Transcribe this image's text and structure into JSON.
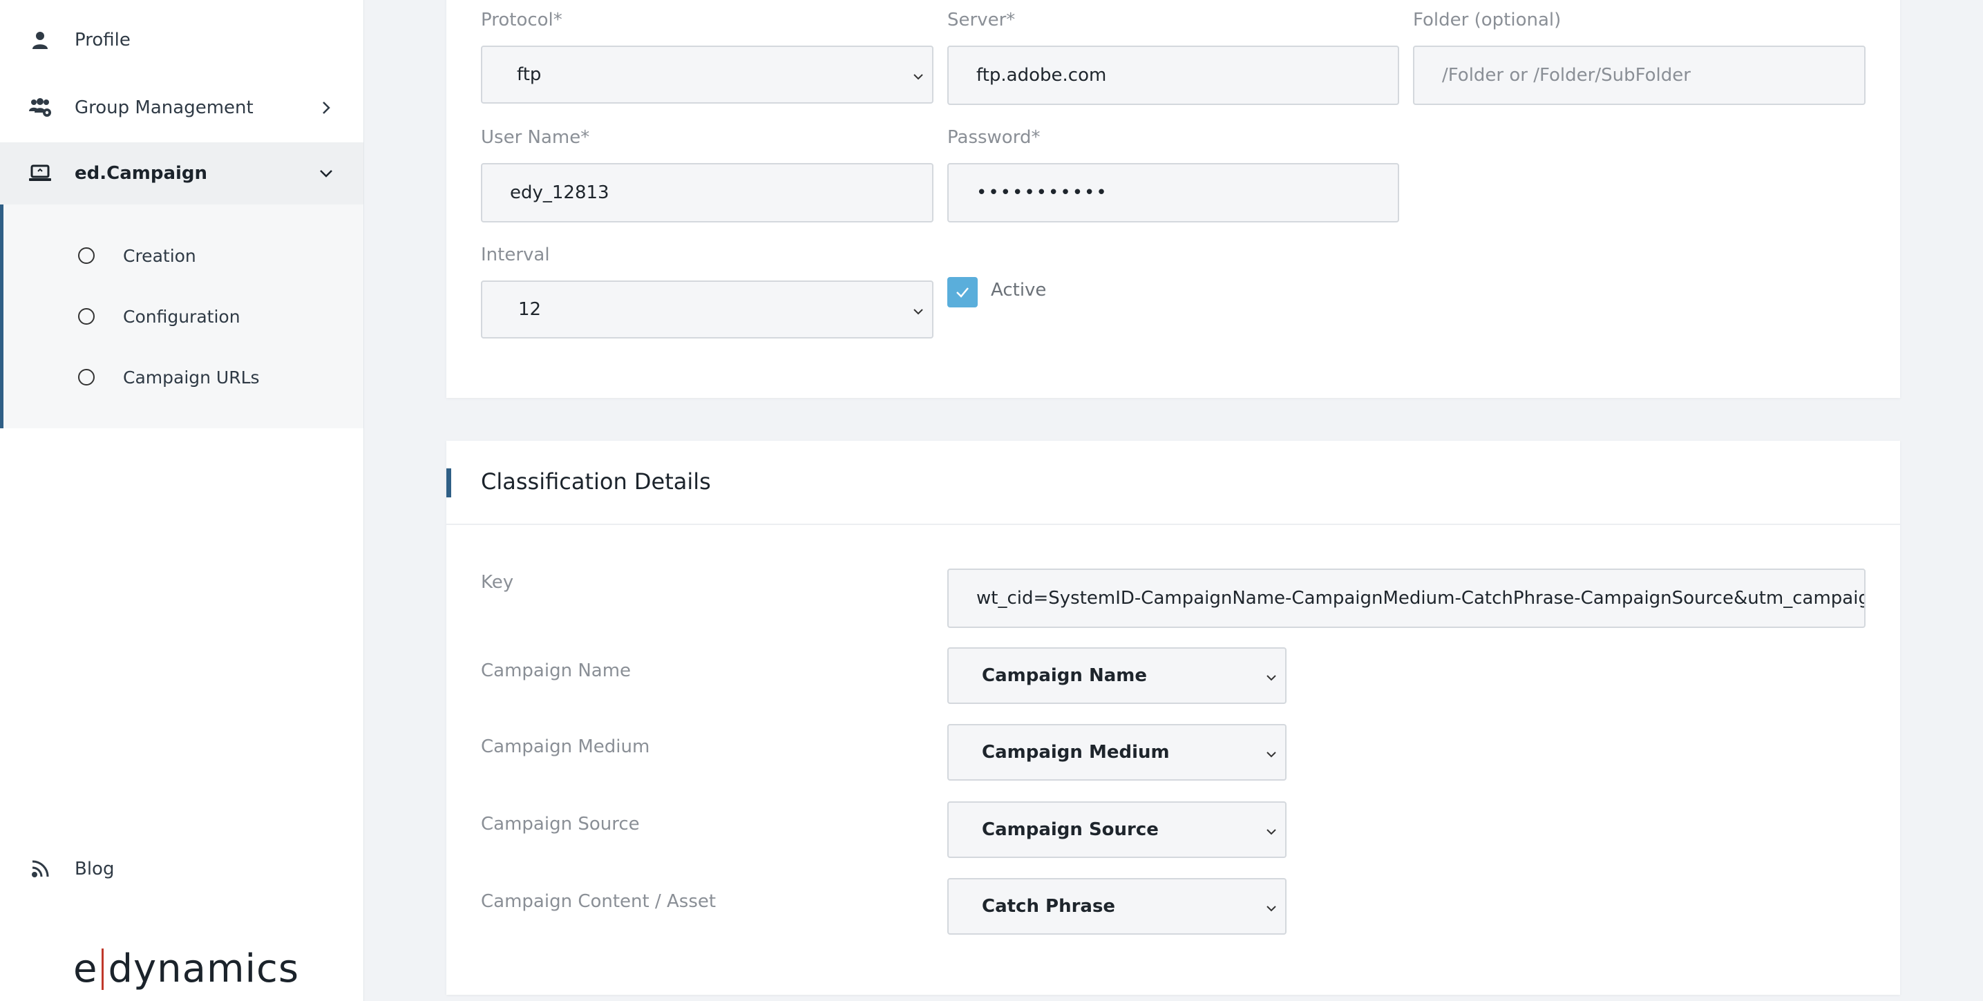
{
  "sidebar": {
    "items": [
      {
        "label": "Profile",
        "icon": "user-icon"
      },
      {
        "label": "Group Management",
        "icon": "group-gear-icon"
      },
      {
        "label": "ed.Campaign",
        "icon": "laptop-icon"
      }
    ],
    "submenu": [
      {
        "label": "Creation"
      },
      {
        "label": "Configuration"
      },
      {
        "label": "Campaign URLs"
      }
    ],
    "blog": {
      "label": "Blog",
      "icon": "blog-feed-icon"
    },
    "logo": {
      "left": "e",
      "right": "dynamics"
    }
  },
  "connection": {
    "protocol": {
      "label": "Protocol*",
      "value": "ftp"
    },
    "server": {
      "label": "Server*",
      "value": "ftp.adobe.com"
    },
    "folder": {
      "label": "Folder (optional)",
      "placeholder": "/Folder or /Folder/SubFolder"
    },
    "username": {
      "label": "User Name*",
      "value": "edy_12813"
    },
    "password": {
      "label": "Password*",
      "value": "•••••••••••"
    },
    "interval": {
      "label": "Interval",
      "value": "12"
    },
    "active": {
      "label": "Active",
      "checked": true
    }
  },
  "classification": {
    "title": "Classification Details",
    "key": {
      "label": "Key",
      "value": "wt_cid=SystemID-CampaignName-CampaignMedium-CatchPhrase-CampaignSource&utm_campaign=&u"
    },
    "campaign_name": {
      "label": "Campaign Name",
      "value": "Campaign Name"
    },
    "campaign_medium": {
      "label": "Campaign Medium",
      "value": "Campaign Medium"
    },
    "campaign_source": {
      "label": "Campaign Source",
      "value": "Campaign Source"
    },
    "campaign_content": {
      "label": "Campaign Content / Asset",
      "value": "Catch Phrase"
    }
  },
  "colors": {
    "accent": "#2f5f86",
    "checkbox": "#5aaedb"
  }
}
